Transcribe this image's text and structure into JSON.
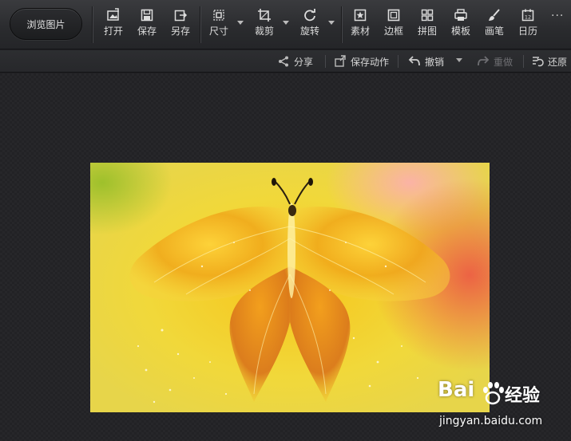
{
  "toolbar": {
    "browse_label": "浏览图片",
    "tools": [
      {
        "label": "打开"
      },
      {
        "label": "保存"
      },
      {
        "label": "另存"
      },
      {
        "label": "尺寸"
      },
      {
        "label": "裁剪"
      },
      {
        "label": "旋转"
      },
      {
        "label": "素材"
      },
      {
        "label": "边框"
      },
      {
        "label": "拼图"
      },
      {
        "label": "模板"
      },
      {
        "label": "画笔"
      },
      {
        "label": "日历"
      }
    ],
    "more": "···"
  },
  "subbar": {
    "share": "分享",
    "save_action": "保存动作",
    "undo": "撤销",
    "redo": "重做",
    "restore": "还原"
  },
  "watermark": {
    "logo_left": "Bai",
    "logo_right": "经验",
    "url": "jingyan.baidu.com"
  },
  "colors": {
    "toolbar_bg": "#2a2b2e",
    "canvas_bg": "#222225",
    "photo_yellow": "#f6c51c"
  }
}
